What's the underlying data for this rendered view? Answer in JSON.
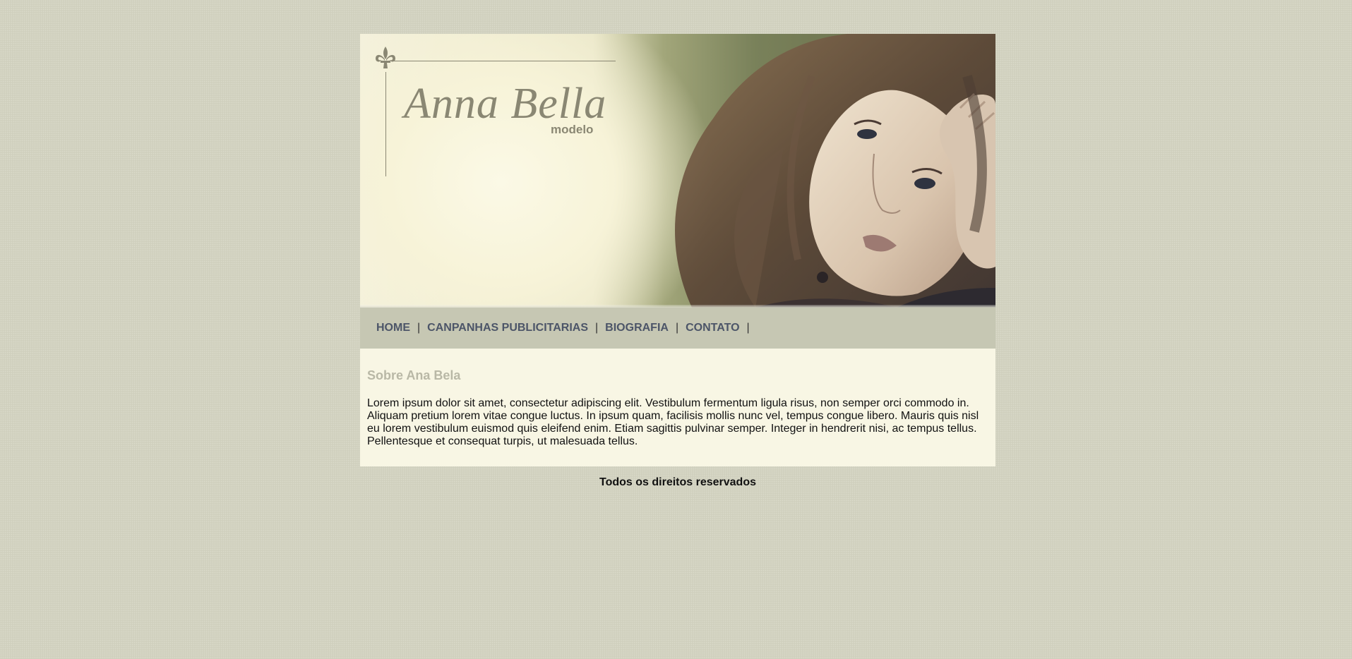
{
  "header": {
    "logo_title": "Anna Bella",
    "logo_subtitle": "modelo",
    "image_alt": "Foto de Anna Bella"
  },
  "nav": {
    "items": [
      {
        "label": "HOME"
      },
      {
        "label": "CANPANHAS PUBLICITARIAS"
      },
      {
        "label": "BIOGRAFIA"
      },
      {
        "label": "CONTATO"
      }
    ],
    "separator": "|"
  },
  "content": {
    "heading": "Sobre Ana Bela",
    "body": "Lorem ipsum dolor sit amet, consectetur adipiscing elit. Vestibulum fermentum ligula risus, non semper orci commodo in. Aliquam pretium lorem vitae congue luctus. In ipsum quam, facilisis mollis nunc vel, tempus congue libero. Mauris quis nisl eu lorem vestibulum euismod quis eleifend enim. Etiam sagittis pulvinar semper. Integer in hendrerit nisi, ac tempus tellus. Pellentesque et consequat turpis, ut malesuada tellus."
  },
  "footer": {
    "text": "Todos os direitos reservados"
  },
  "colors": {
    "page_background": "#d3d3c1",
    "nav_background": "#c6c7b3",
    "nav_link": "#4c5568",
    "content_background": "#f8f6e4",
    "heading": "#b9b8a6",
    "logo": "#8a8773"
  },
  "icons": {
    "logo_ornament": "fleur-de-lis-icon"
  }
}
